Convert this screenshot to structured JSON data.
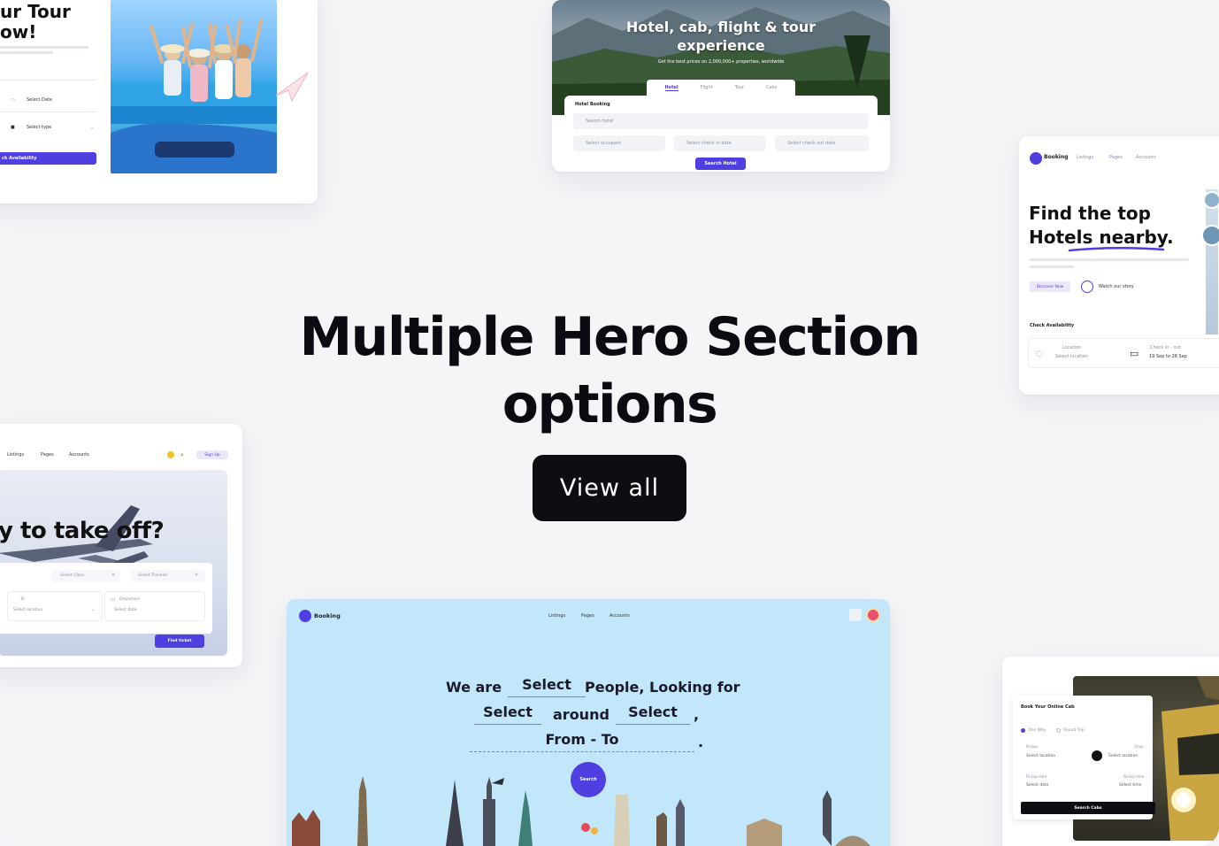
{
  "hero": {
    "title_line1": "Multiple Hero Section",
    "title_line2": "options",
    "cta_label": "View all"
  },
  "colors": {
    "background": "#f5f5f8",
    "cta_bg": "#0d0d14",
    "accent": "#4f3ee0",
    "sky": "#c2e7fb"
  },
  "previews": {
    "tour": {
      "headline_line1": "ur Tour",
      "headline_line2": "ow!",
      "field1_label": "Select Date",
      "field2_label": "Select type",
      "button": "ck Availability"
    },
    "hotel": {
      "title_line1": "Hotel, cab, flight & tour",
      "title_line2": "experience",
      "subtitle": "Get the best prices on 2,000,000+ properties, worldwide",
      "tabs": [
        "Hotel",
        "Flight",
        "Tour",
        "Cabs"
      ],
      "section_label": "Hotel Booking",
      "search_placeholder": "Search hotel",
      "fields": [
        "Select occupant",
        "Select check in date",
        "Select check out date"
      ],
      "button": "Search Hotel"
    },
    "nearby": {
      "brand": "Booking",
      "nav": [
        "Listings",
        "Pages",
        "Accounts"
      ],
      "title_line1": "Find the top",
      "title_line2": "Hotels nearby.",
      "discover": "Discover Now",
      "watch": "Watch our story",
      "check_label": "Check Availability",
      "location_label": "Location",
      "location_value": "Select location",
      "checkin_label": "Check in - out",
      "checkin_value": "19 Sep to 28 Sep"
    },
    "flight": {
      "nav": [
        "Listings",
        "Pages",
        "Accounts"
      ],
      "signup": "Sign Up",
      "headline": "y to take off?",
      "class_select": "Select Class",
      "traveler_select": "Select Traveler",
      "to_label": "To",
      "to_value": "Select location",
      "departure_label": "Departure",
      "departure_value": "Select date",
      "button": "Find ticket"
    },
    "explore": {
      "brand": "Booking",
      "nav": [
        "Listings",
        "Pages",
        "Accounts"
      ],
      "line1_a": "We are",
      "line1_b": "Select",
      "line1_c": "People, Looking for",
      "line2_a": "Select",
      "line2_b": "around",
      "line2_c": "Select",
      "line2_d": ",",
      "line3_a": "From - To",
      "line3_b": ".",
      "button": "Search"
    },
    "cab": {
      "title": "Book Your Online Cab",
      "opt1": "One Way",
      "opt2": "Round Trip",
      "pickup_label": "Pickup",
      "pickup_value": "Select location",
      "drop_label": "Drop",
      "drop_value": "Select location",
      "pdate_label": "Pickup date",
      "pdate_value": "Select date",
      "ptime_label": "Pickup time",
      "ptime_value": "Select time",
      "button": "Search Cabs"
    }
  }
}
